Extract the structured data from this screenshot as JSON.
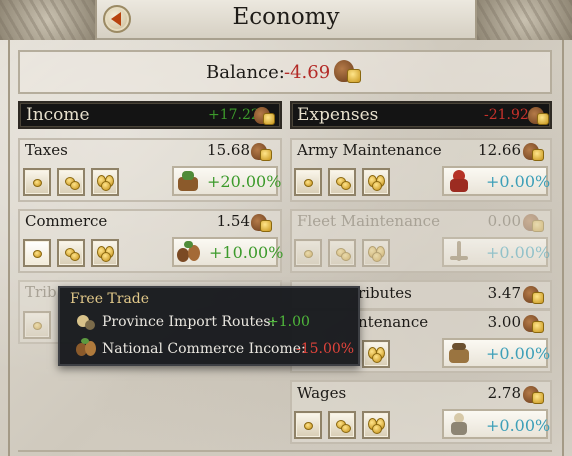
{
  "header": {
    "title": "Economy"
  },
  "balance": {
    "label": "Balance:",
    "value": "-4.69"
  },
  "income": {
    "title": "Income",
    "total": "+17.22",
    "rows": [
      {
        "label": "Taxes",
        "amount": "15.68",
        "modifier": "+20.00%"
      },
      {
        "label": "Commerce",
        "amount": "1.54",
        "modifier": "+10.00%"
      },
      {
        "label": "Trib"
      }
    ]
  },
  "expenses": {
    "title": "Expenses",
    "total": "-21.92",
    "rows": [
      {
        "label": "Army Maintenance",
        "amount": "12.66",
        "modifier": "+0.00%"
      },
      {
        "label": "Fleet Maintenance",
        "amount": "0.00",
        "modifier": "+0.00%"
      },
      {
        "label": "ributes",
        "amount": "3.47"
      },
      {
        "label": "ntenance",
        "amount": "3.00",
        "modifier": "+0.00%"
      },
      {
        "label": "Wages",
        "amount": "2.78",
        "modifier": "+0.00%"
      }
    ]
  },
  "tooltip": {
    "title": "Free Trade",
    "lines": [
      {
        "label": "Province Import Routes:",
        "value": "+1.00"
      },
      {
        "label": "National Commerce Income:",
        "value": "-15.00%"
      }
    ]
  },
  "colors": {
    "positive": "#3c9a2b",
    "negative": "#c7312b",
    "neutral_modifier": "#3d9fb8",
    "header_bg": "#141414"
  }
}
